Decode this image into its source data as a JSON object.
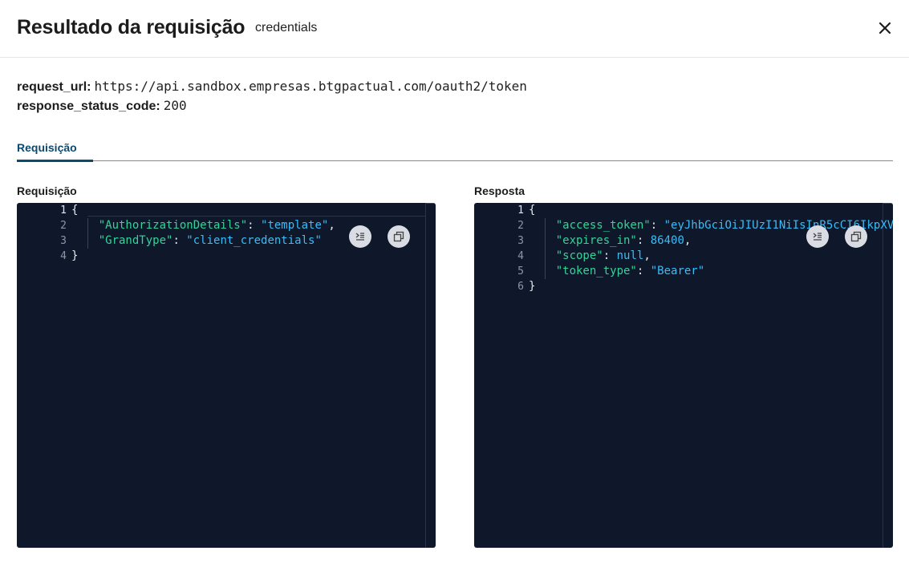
{
  "header": {
    "title": "Resultado da requisição",
    "subtitle": "credentials",
    "close_icon": "close-icon"
  },
  "meta": {
    "request_url_label": "request_url:",
    "request_url_value": "https://api.sandbox.empresas.btgpactual.com/oauth2/token",
    "status_code_label": "response_status_code:",
    "status_code_value": "200"
  },
  "tabs": [
    {
      "label": "Requisição",
      "active": true
    }
  ],
  "request": {
    "label": "Requisição",
    "line_numbers": [
      "1",
      "2",
      "3",
      "4"
    ],
    "lines": [
      {
        "indent": "",
        "open": "{"
      },
      {
        "indent": "    ",
        "key": "\"AuthorizationDetails\"",
        "colon": ": ",
        "value": "\"template\"",
        "value_type": "str",
        "trail": ","
      },
      {
        "indent": "    ",
        "key": "\"GrandType\"",
        "colon": ": ",
        "value": "\"client_credentials\"",
        "value_type": "str",
        "trail": ""
      },
      {
        "indent": "",
        "open": "}"
      }
    ],
    "format_icon": "format-code-icon",
    "copy_icon": "copy-icon"
  },
  "response": {
    "label": "Resposta",
    "line_numbers": [
      "1",
      "2",
      "3",
      "4",
      "5",
      "6"
    ],
    "lines": [
      {
        "indent": "",
        "open": "{"
      },
      {
        "indent": "    ",
        "key": "\"access_token\"",
        "colon": ": ",
        "value": "\"eyJhbGciOiJIUzI1NiIsInR5cCI6IkpXV",
        "value_type": "str",
        "trail": ""
      },
      {
        "indent": "    ",
        "key": "\"expires_in\"",
        "colon": ": ",
        "value": "86400",
        "value_type": "num",
        "trail": ","
      },
      {
        "indent": "    ",
        "key": "\"scope\"",
        "colon": ": ",
        "value": "null",
        "value_type": "kw",
        "trail": ","
      },
      {
        "indent": "    ",
        "key": "\"token_type\"",
        "colon": ": ",
        "value": "\"Bearer\"",
        "value_type": "str",
        "trail": ""
      },
      {
        "indent": "",
        "open": "}"
      }
    ],
    "format_icon": "format-code-icon",
    "copy_icon": "copy-icon"
  },
  "colors": {
    "editor_bg": "#0f172a",
    "json_key": "#34d399",
    "json_value": "#38bdf8",
    "tab_accent": "#0b4a6f"
  }
}
